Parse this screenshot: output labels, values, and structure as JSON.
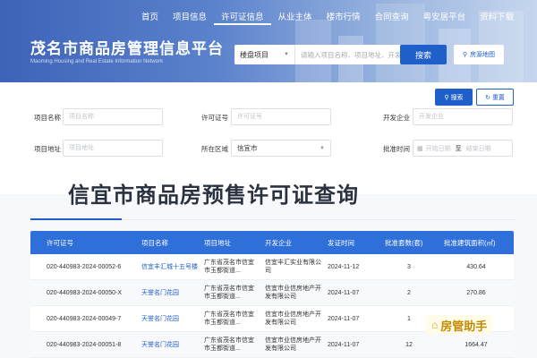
{
  "nav": {
    "items": [
      "首页",
      "项目信息",
      "许可证信息",
      "从业主体",
      "楼市行情",
      "合同查询",
      "粤安居平台",
      "资料下载"
    ]
  },
  "header": {
    "title": "茂名市商品房管理信息平台",
    "subtitle": "Maoming Housing and Real Estate Information Network",
    "search_type": "楼盘项目",
    "search_placeholder": "请输入项目名称、项目地址、开发",
    "search_button": "搜索",
    "map_button": "房源地图"
  },
  "form": {
    "project_name_label": "项目名称",
    "project_name_placeholder": "项目名称",
    "license_no_label": "许可证号",
    "license_no_placeholder": "许可证号",
    "developer_label": "开发企业",
    "developer_placeholder": "开发企业",
    "project_addr_label": "项目地址",
    "project_addr_placeholder": "项目地址",
    "region_label": "所在区域",
    "region_value": "信宜市",
    "approve_time_label": "批准时间",
    "date_start_placeholder": "开始日期",
    "date_sep": "至",
    "date_end_placeholder": "结束日期",
    "search_button": "搜索",
    "reset_button": "重置"
  },
  "page_title": "信宜市商品房预售许可证查询",
  "table": {
    "headers": [
      "许可证号",
      "项目名称",
      "项目地址",
      "开发企业",
      "发证时间",
      "批准套数(套)",
      "批准建筑面积(㎡)"
    ],
    "rows": [
      [
        "020-440983-2024-00052-6",
        "信宜丰汇城十五号楼",
        "广东省茂名市信宜市玉都街道...",
        "信宜丰汇实业有限公司",
        "2024-11-12",
        "3",
        "430.64"
      ],
      [
        "020-440983-2024-00050-X",
        "天誉名门花园",
        "广东省茂名市信宜市玉都街道...",
        "信宜市业信房地产开发有限公司",
        "2024-11-07",
        "2",
        "270.86"
      ],
      [
        "020-440983-2024-00049-7",
        "天誉名门花园",
        "广东省茂名市信宜市玉都街道...",
        "信宜市业信房地产开发有限公司",
        "2024-11-07",
        "1",
        ""
      ],
      [
        "020-440983-2024-00051-8",
        "天誉名门花园",
        "广东省茂名市信宜市玉都街道...",
        "信宜市业信房地产开发有限公司",
        "2024-11-07",
        "12",
        "1664.47"
      ]
    ]
  },
  "watermark": "房管助手",
  "colors": {
    "primary": "#1f5fc9",
    "table_header": "#2f6fd9"
  }
}
